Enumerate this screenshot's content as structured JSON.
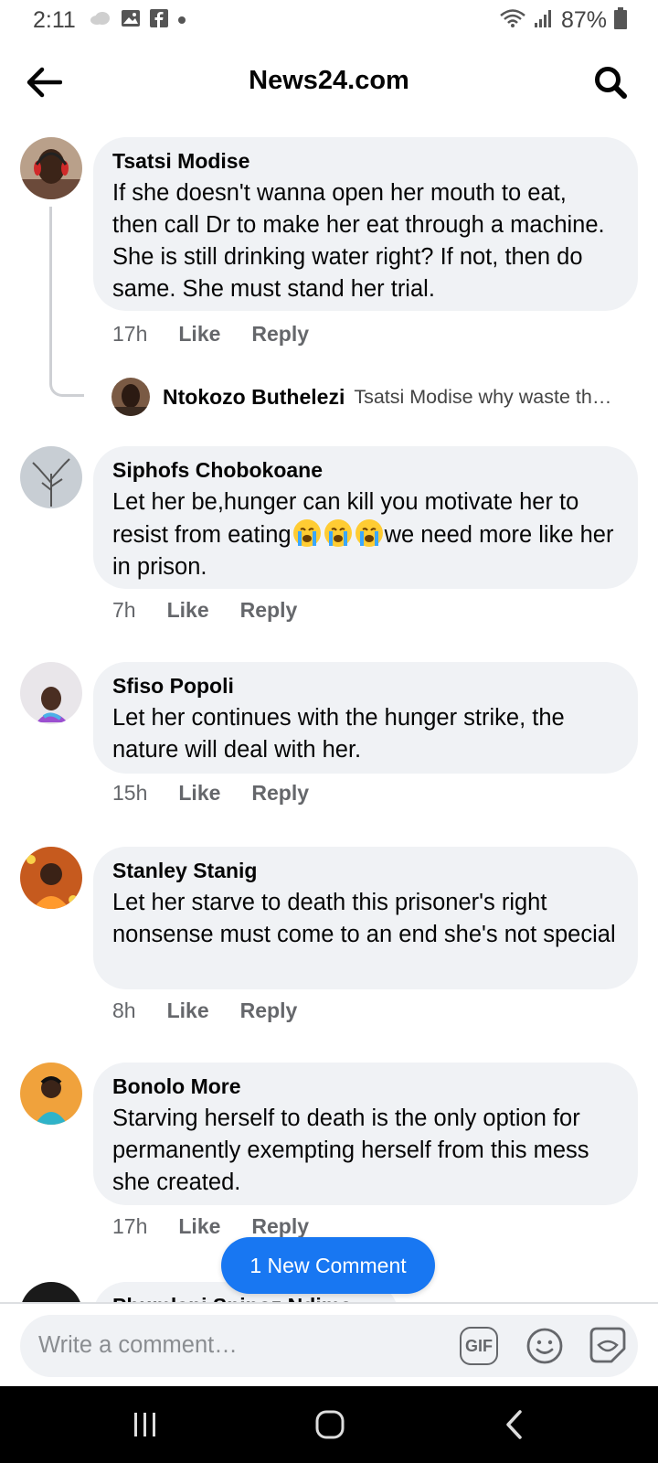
{
  "status_bar": {
    "time": "2:11",
    "battery": "87%"
  },
  "header": {
    "title": "News24.com"
  },
  "comments": [
    {
      "author": "Tsatsi Modise",
      "text": "If she doesn't wanna open her mouth to eat, then call Dr to make her eat through a machine. She is still drinking water right? If not, then do same. She must stand her trial.",
      "time": "17h",
      "like": "Like",
      "reply": "Reply",
      "replies": [
        {
          "author": "Ntokozo Buthelezi",
          "snippet": "Tsatsi Modise why waste th…"
        }
      ]
    },
    {
      "author": "Siphofs Chobokoane",
      "text_before": "Let her be,hunger can kill you motivate her to resist from eating",
      "emojis": [
        "crying-face",
        "crying-face",
        "crying-face"
      ],
      "text_after": "we need more like her in prison.",
      "time": "7h",
      "like": "Like",
      "reply": "Reply"
    },
    {
      "author": "Sfiso Popoli",
      "text": "Let her continues with the hunger strike, the nature will deal with her.",
      "time": "15h",
      "like": "Like",
      "reply": "Reply"
    },
    {
      "author": "Stanley Stanig",
      "text": "Let her starve to death this prisoner's right nonsense must come to an end she's not special",
      "time": "8h",
      "like": "Like",
      "reply": "Reply"
    },
    {
      "author": "Bonolo More",
      "text": "Starving herself to death is the only option for permanently exempting herself from this mess she created.",
      "time": "17h",
      "like": "Like",
      "reply": "Reply"
    },
    {
      "author": "Phumlani Spinoz Ndima"
    }
  ],
  "new_comment_pill": "1 New Comment",
  "composer": {
    "placeholder": "Write a comment…",
    "gif_label": "GIF"
  },
  "icons": {
    "status": [
      "cloud-icon",
      "image-icon",
      "facebook-icon",
      "dot-icon",
      "wifi-icon",
      "signal-icon",
      "battery-icon"
    ],
    "header": [
      "back-arrow-icon",
      "search-icon"
    ],
    "composer": [
      "gif-icon",
      "emoji-icon",
      "sticker-icon"
    ],
    "nav": [
      "recent-apps-icon",
      "home-icon",
      "back-icon"
    ]
  },
  "colors": {
    "accent": "#1877f2",
    "bubble": "#f0f2f5",
    "secondary_text": "#65676b",
    "nav_bar": "#000000"
  }
}
